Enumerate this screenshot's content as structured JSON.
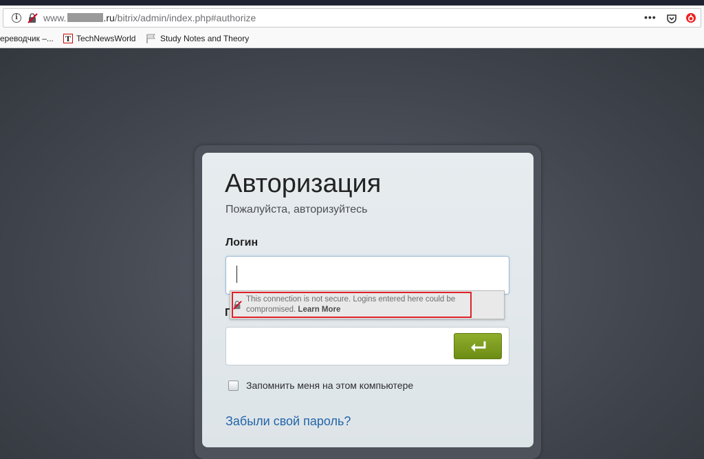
{
  "browser": {
    "url": {
      "prefix": "www.",
      "domain": ".ru",
      "path": "/bitrix/admin/index.php#authorize"
    },
    "menu_dots": "•••"
  },
  "bookmarks": [
    {
      "label": "ереводчик –...",
      "icon": "none"
    },
    {
      "label": "TechNewsWorld",
      "icon": "t-logo-icon",
      "icon_letter": "T"
    },
    {
      "label": "Study Notes and Theory",
      "icon": "flag-icon"
    }
  ],
  "login_form": {
    "title": "Авторизация",
    "subtitle": "Пожалуйста, авторизуйтесь",
    "login_label": "Логин",
    "login_value": "",
    "password_label": "П",
    "password_value": "",
    "submit_icon": "enter-arrow-icon",
    "remember_label": "Запомнить меня на этом компьютере",
    "remember_checked": false,
    "forgot_link": "Забыли свой пароль?"
  },
  "insecure_warning": {
    "text": "This connection is not secure. Logins entered here could be compromised.",
    "link": "Learn More"
  },
  "colors": {
    "accent_link": "#2265a8",
    "submit_green": "#7a9a1c",
    "warning_outline": "#e0202a"
  }
}
